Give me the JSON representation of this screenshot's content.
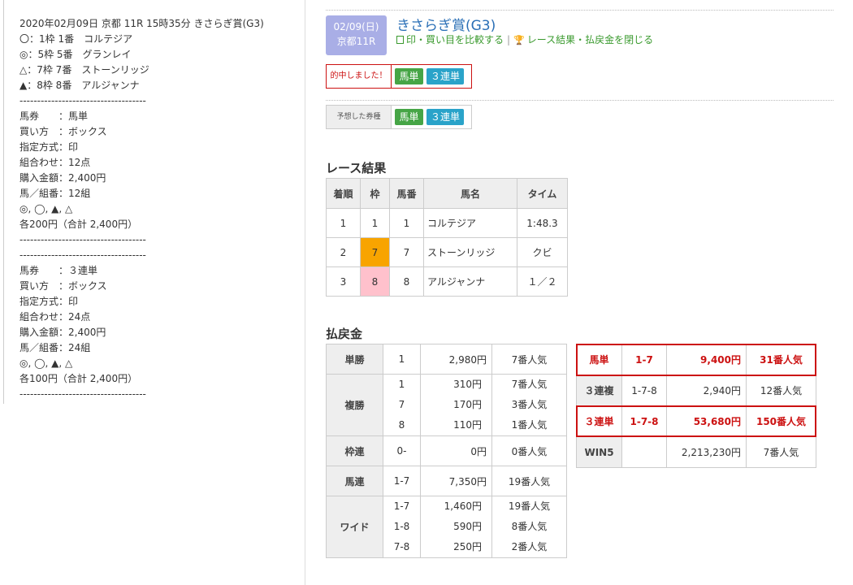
{
  "left": {
    "lines": [
      "2020年02月09日 京都 11R 15時35分 きさらぎ賞(G3)",
      "〇：1枠 1番　コルテジア",
      "◎：5枠 5番　グランレイ",
      "△：7枠 7番　ストーンリッジ",
      "▲：8枠 8番　アルジャンナ",
      "------------------------------------",
      "馬券　　：馬単",
      "買い方　：ボックス",
      "指定方式：印",
      "組合わせ：12点",
      "購入金額：2,400円",
      "馬／組番：12組",
      "◎, ◯, ▲, △",
      "各200円（合計 2,400円）",
      "------------------------------------",
      "------------------------------------",
      "馬券　　：３連単",
      "買い方　：ボックス",
      "指定方式：印",
      "組合わせ：24点",
      "購入金額：2,400円",
      "馬／組番：24組",
      "◎, ◯, ▲, △",
      "各100円（合計 2,400円）",
      "------------------------------------"
    ]
  },
  "race": {
    "date": "02/09(日)",
    "venue": "京都11R",
    "title": "きさらぎ賞(G3)",
    "compare_link": "印・買い目を比較する",
    "close_link": "レース結果・払戻金を閉じる",
    "separator": "|"
  },
  "hit": {
    "label": "的中しました！",
    "tags": [
      "馬単",
      "３連単"
    ]
  },
  "predicted": {
    "label": "予想した券種",
    "tags": [
      "馬単",
      "３連単"
    ]
  },
  "result": {
    "heading": "レース結果",
    "headers": [
      "着順",
      "枠",
      "馬番",
      "馬名",
      "タイム"
    ],
    "rows": [
      {
        "rank": "1",
        "waku": "1",
        "num": "1",
        "name": "コルテジア",
        "time": "1:48.3"
      },
      {
        "rank": "2",
        "waku": "7",
        "num": "7",
        "name": "ストーンリッジ",
        "time": "クビ"
      },
      {
        "rank": "3",
        "waku": "8",
        "num": "8",
        "name": "アルジャンナ",
        "time": "１／２"
      }
    ]
  },
  "payout": {
    "heading": "払戻金",
    "left_rows": [
      {
        "type": "単勝",
        "combos": [
          "1"
        ],
        "amounts": [
          "2,980円"
        ],
        "pops": [
          "7番人気"
        ]
      },
      {
        "type": "複勝",
        "combos": [
          "1",
          "7",
          "8"
        ],
        "amounts": [
          "310円",
          "170円",
          "110円"
        ],
        "pops": [
          "7番人気",
          "3番人気",
          "1番人気"
        ]
      },
      {
        "type": "枠連",
        "combos": [
          "0-"
        ],
        "amounts": [
          "0円"
        ],
        "pops": [
          "0番人気"
        ]
      },
      {
        "type": "馬連",
        "combos": [
          "1-7"
        ],
        "amounts": [
          "7,350円"
        ],
        "pops": [
          "19番人気"
        ]
      },
      {
        "type": "ワイド",
        "combos": [
          "1-7",
          "1-8",
          "7-8"
        ],
        "amounts": [
          "1,460円",
          "590円",
          "250円"
        ],
        "pops": [
          "19番人気",
          "8番人気",
          "2番人気"
        ]
      }
    ],
    "right_rows": [
      {
        "type": "馬単",
        "combo": "1-7",
        "amount": "9,400円",
        "pop": "31番人気",
        "hit": true
      },
      {
        "type": "３連複",
        "combo": "1-7-8",
        "amount": "2,940円",
        "pop": "12番人気",
        "hit": false
      },
      {
        "type": "３連単",
        "combo": "1-7-8",
        "amount": "53,680円",
        "pop": "150番人気",
        "hit": true
      },
      {
        "type": "WIN5",
        "combo": "",
        "amount": "2,213,230円",
        "pop": "7番人気",
        "hit": false
      }
    ]
  },
  "colors": {
    "accent_blue": "#2a6fb6",
    "link_green": "#3a9a2e",
    "hit_red": "#cc1111",
    "waku7": "#f8a400",
    "waku8": "#ffc1cc",
    "date_badge": "#a9aee6"
  }
}
